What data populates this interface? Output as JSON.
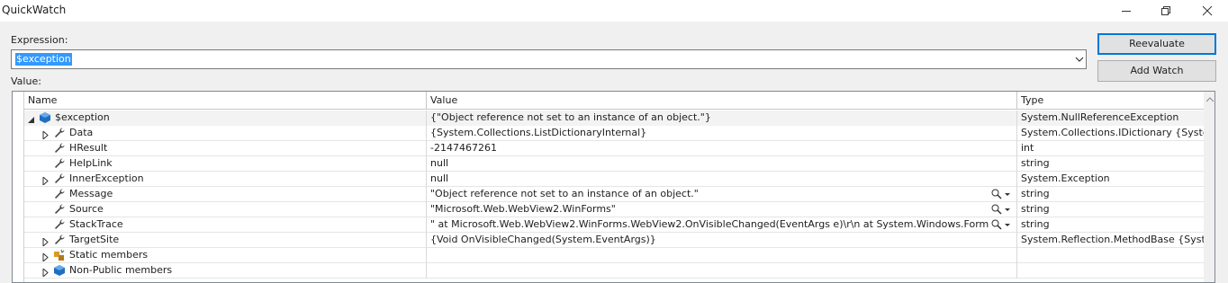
{
  "window": {
    "title": "QuickWatch"
  },
  "expression": {
    "label": "Expression:",
    "value": "$exception"
  },
  "buttons": {
    "reevaluate": "Reevaluate",
    "add_watch": "Add Watch"
  },
  "value_label": "Value:",
  "grid": {
    "columns": {
      "name": "Name",
      "value": "Value",
      "type": "Type"
    },
    "rows": [
      {
        "name": "$exception",
        "value": "{\"Object reference not set to an instance of an object.\"}",
        "type": "System.NullReferenceException",
        "expander": "expanded",
        "icon": "object-icon",
        "indent": 0,
        "magnifier": false
      },
      {
        "name": "Data",
        "value": "{System.Collections.ListDictionaryInternal}",
        "type": "System.Collections.IDictionary {Syste...",
        "expander": "collapsed",
        "icon": "wrench-icon",
        "indent": 1,
        "magnifier": false
      },
      {
        "name": "HResult",
        "value": "-2147467261",
        "type": "int",
        "expander": "none",
        "icon": "wrench-icon",
        "indent": 1,
        "magnifier": false
      },
      {
        "name": "HelpLink",
        "value": "null",
        "type": "string",
        "expander": "none",
        "icon": "wrench-icon",
        "indent": 1,
        "magnifier": false
      },
      {
        "name": "InnerException",
        "value": "null",
        "type": "System.Exception",
        "expander": "collapsed",
        "icon": "wrench-icon",
        "indent": 1,
        "magnifier": false
      },
      {
        "name": "Message",
        "value": "\"Object reference not set to an instance of an object.\"",
        "type": "string",
        "expander": "none",
        "icon": "wrench-icon",
        "indent": 1,
        "magnifier": true
      },
      {
        "name": "Source",
        "value": "\"Microsoft.Web.WebView2.WinForms\"",
        "type": "string",
        "expander": "none",
        "icon": "wrench-icon",
        "indent": 1,
        "magnifier": true
      },
      {
        "name": "StackTrace",
        "value": "\"   at Microsoft.Web.WebView2.WinForms.WebView2.OnVisibleChanged(EventArgs e)\\r\\n   at System.Windows.Form...",
        "type": "string",
        "expander": "none",
        "icon": "wrench-icon",
        "indent": 1,
        "magnifier": true
      },
      {
        "name": "TargetSite",
        "value": "{Void OnVisibleChanged(System.EventArgs)}",
        "type": "System.Reflection.MethodBase {Syste...",
        "expander": "collapsed",
        "icon": "wrench-icon",
        "indent": 1,
        "magnifier": false
      },
      {
        "name": "Static members",
        "value": "",
        "type": "",
        "expander": "collapsed",
        "icon": "static-members-icon",
        "indent": 1,
        "magnifier": false
      },
      {
        "name": "Non-Public members",
        "value": "",
        "type": "",
        "expander": "collapsed",
        "icon": "object-icon",
        "indent": 1,
        "magnifier": false
      }
    ]
  },
  "colors": {
    "selection": "#3399ff",
    "default_button_border": "#0078d7",
    "object_icon": "#1e6fc1",
    "wrench_icon": "#424242",
    "static_icon": "#d99a2b"
  }
}
